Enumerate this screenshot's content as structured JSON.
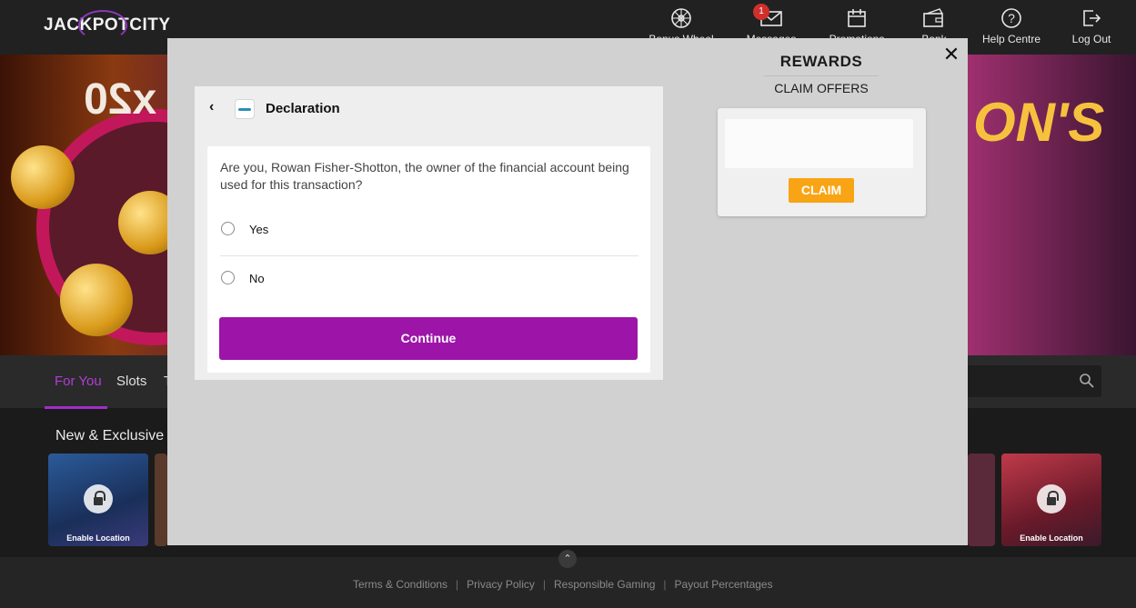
{
  "header": {
    "logo_text": "JACKPOTCITY",
    "nav": [
      {
        "label": "Bonus Wheel",
        "icon": "wheel-icon"
      },
      {
        "label": "Messages",
        "icon": "envelope-icon",
        "badge": "1"
      },
      {
        "label": "Promotions",
        "icon": "calendar-icon"
      },
      {
        "label": "Bank",
        "icon": "wallet-icon"
      },
      {
        "label": "Help Centre",
        "icon": "question-icon"
      },
      {
        "label": "Log Out",
        "icon": "logout-icon"
      }
    ]
  },
  "hero": {
    "left_text": "x20",
    "right_text": "ON'S"
  },
  "categories": {
    "items": [
      "For You",
      "Slots",
      "T"
    ],
    "active": "For You"
  },
  "games": {
    "section_title": "New & Exclusive",
    "tiles": [
      {
        "caption": "Enable Location"
      },
      {
        "caption": "Enable Location"
      }
    ]
  },
  "footer": {
    "links": [
      "Terms & Conditions",
      "Privacy Policy",
      "Responsible Gaming",
      "Payout Percentages"
    ],
    "separator": "|"
  },
  "rewards": {
    "title": "REWARDS",
    "subtitle": "CLAIM OFFERS",
    "claim_label": "CLAIM"
  },
  "declaration": {
    "title": "Declaration",
    "question": "Are you, Rowan Fisher-Shotton, the owner of the financial account being used for this transaction?",
    "options": [
      "Yes",
      "No"
    ],
    "continue_label": "Continue"
  },
  "colors": {
    "accent_purple": "#9d14a8",
    "claim_orange": "#f8a414",
    "active_tab": "#b33cd6"
  }
}
